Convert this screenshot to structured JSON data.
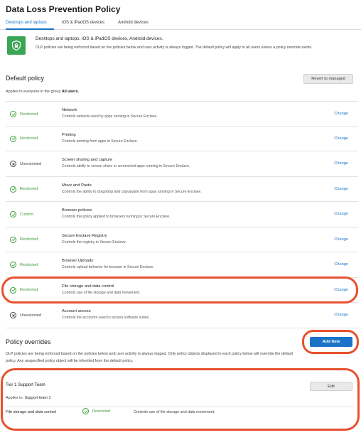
{
  "page": {
    "title": "Data Loss Prevention Policy",
    "tabs": [
      {
        "label": "Desktops and laptops",
        "active": true
      },
      {
        "label": "iOS & iPadOS devices",
        "active": false
      },
      {
        "label": "Android devices",
        "active": false
      }
    ]
  },
  "banner": {
    "icon": "shield-lock-icon",
    "title": "Desktops and laptops, iOS & iPadOS devices, Android devices.",
    "description": "DLP policies are being enforced based on the policies below and user activity is always logged. The default policy will apply to all users unless a policy override exists."
  },
  "default_policy": {
    "title": "Default policy",
    "revert_label": "Revert to managed",
    "applies_prefix": "Applies to everyone in the group",
    "applies_group": "All users.",
    "change_label": "Change",
    "rows": [
      {
        "status": "Restricted",
        "status_type": "restricted",
        "name": "Network",
        "description": "Controls network used by apps running in Secure Enclave."
      },
      {
        "status": "Restricted",
        "status_type": "restricted",
        "name": "Printing",
        "description": "Controls printing from apps in Secure Enclave."
      },
      {
        "status": "Unrestricted",
        "status_type": "unrestricted",
        "name": "Screen sharing and capture",
        "description": "Controls ability to screen share or screenshot apps running in Secure Enclave."
      },
      {
        "status": "Restricted",
        "status_type": "restricted",
        "name": "Move and Paste",
        "description": "Controls the ability to drag/drop and copy/paste from apps running in Secure Enclave."
      },
      {
        "status": "Custom",
        "status_type": "custom",
        "name": "Browser policies",
        "description": "Controls the policy applied to browsers running in Secure Enclave."
      },
      {
        "status": "Restricted",
        "status_type": "restricted",
        "name": "Secure Enclave Registry",
        "description": "Controls the registry in Secure Enclave."
      },
      {
        "status": "Restricted",
        "status_type": "restricted",
        "name": "Browser Uploads",
        "description": "Controls upload behavior for browser in Secure Enclave."
      },
      {
        "status": "Restricted",
        "status_type": "restricted",
        "name": "File storage and data control",
        "description": "Controls use of file storage and data movement."
      },
      {
        "status": "Unrestricted",
        "status_type": "unrestricted",
        "name": "Account access",
        "description": "Controls the accounts used to access software suites."
      }
    ]
  },
  "overrides": {
    "title": "Policy overrides",
    "add_label": "Add New",
    "description": "DLP policies are being enforced based on the policies below and user activity is always logged. Only policy objects displayed in each policy below will override the default policy. Any unspecified policy object will be inherited from the default policy.",
    "card": {
      "title": "Tier 1 Support Team",
      "edit_label": "Edit",
      "applies_prefix": "Applies to:",
      "applies_value": "Support team 1",
      "policy_name": "File storage and data control",
      "policy_status": "Restricted",
      "policy_description": "Controls use of file storage and data movement."
    }
  },
  "colors": {
    "accent": "#1a73c7",
    "restricted": "#3a9a3a",
    "highlight": "#e8502e"
  }
}
